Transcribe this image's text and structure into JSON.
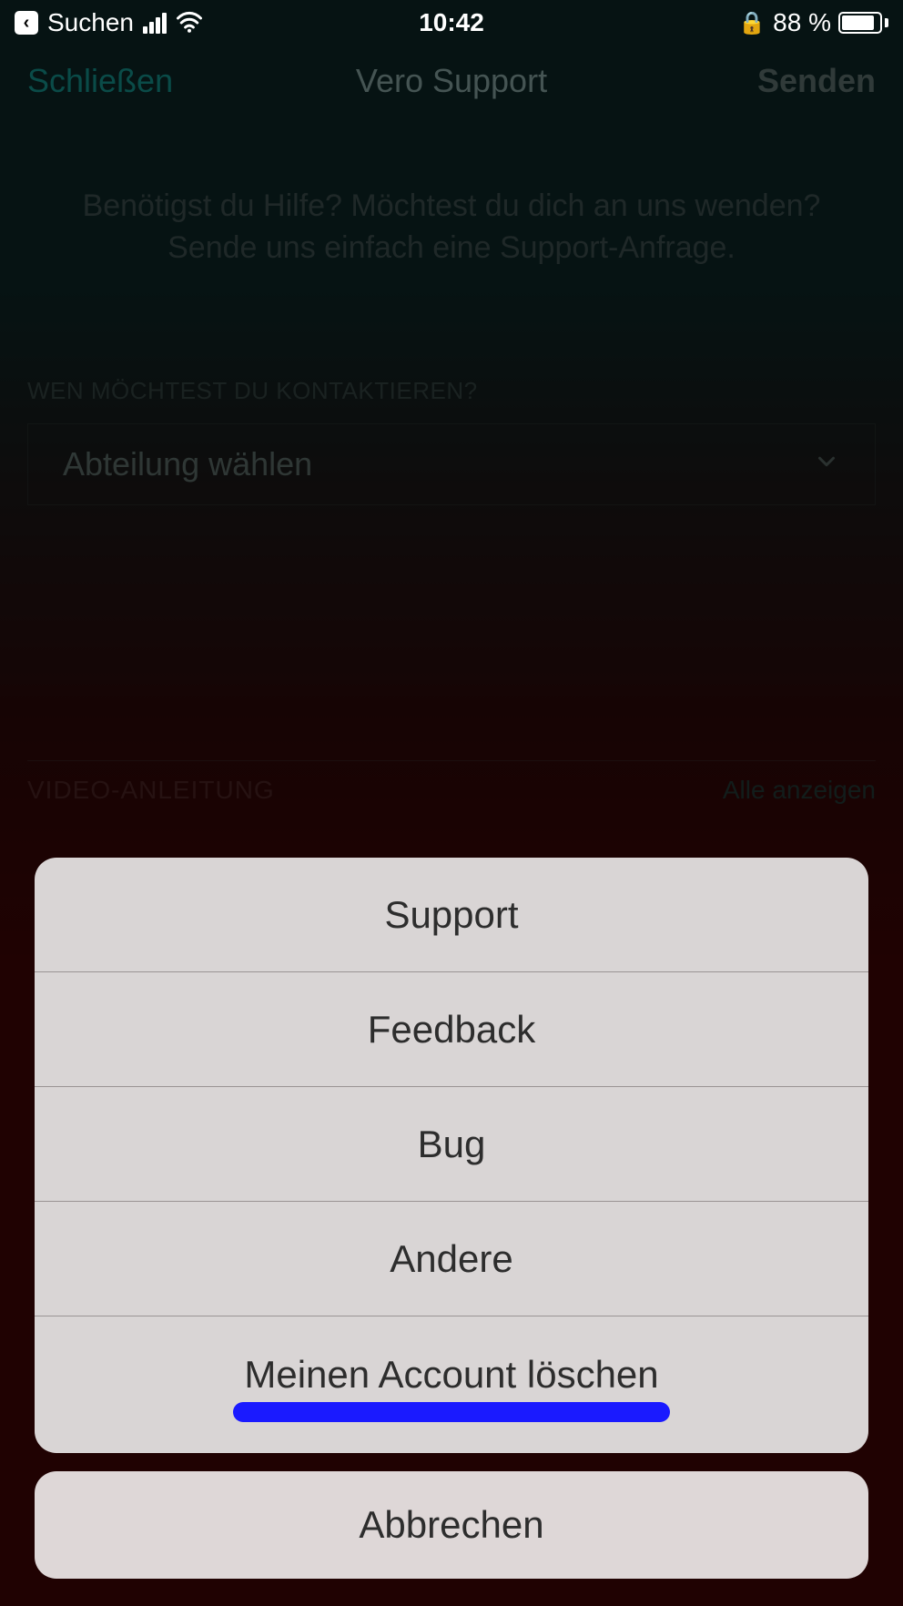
{
  "status": {
    "back_app": "Suchen",
    "time": "10:42",
    "battery_pct": "88 %",
    "lock_glyph": "⊘"
  },
  "nav": {
    "close": "Schließen",
    "title": "Vero Support",
    "send": "Senden"
  },
  "page": {
    "help_text": "Benötigst du Hilfe? Möchtest du dich an uns wenden? Sende uns einfach eine Support-Anfrage.",
    "contact_label": "WEN MÖCHTEST DU KONTAKTIEREN?",
    "select_placeholder": "Abteilung wählen",
    "video_label": "VIDEO-ANLEITUNG",
    "video_link": "Alle anzeigen"
  },
  "sheet": {
    "options": [
      "Support",
      "Feedback",
      "Bug",
      "Andere",
      "Meinen Account löschen"
    ],
    "cancel": "Abbrechen"
  }
}
